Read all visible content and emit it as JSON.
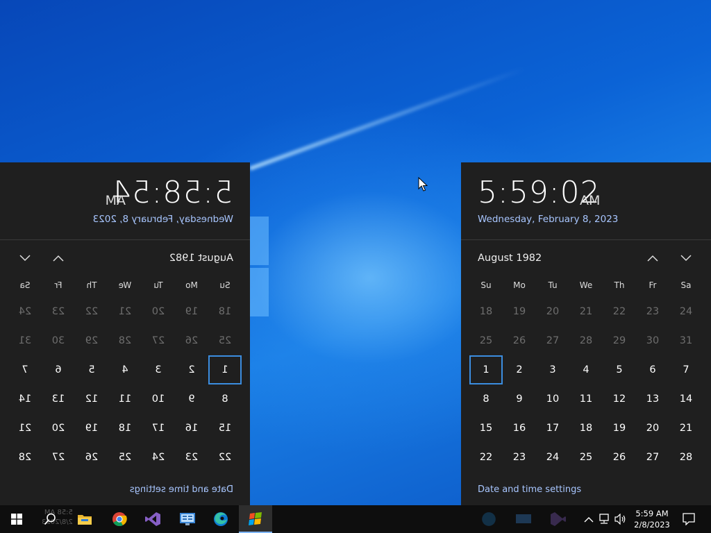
{
  "clock": {
    "time_left": "5:58:54",
    "time_right": "5:59:02",
    "ampm": "AM",
    "date": "Wednesday, February 8, 2023"
  },
  "calendar": {
    "month": "August 1982",
    "weekdays": [
      "Su",
      "Mo",
      "Tu",
      "We",
      "Th",
      "Fr",
      "Sa"
    ],
    "weeks": [
      [
        "18",
        "19",
        "20",
        "21",
        "22",
        "23",
        "24"
      ],
      [
        "25",
        "26",
        "27",
        "28",
        "29",
        "30",
        "31"
      ],
      [
        "1",
        "2",
        "3",
        "4",
        "5",
        "6",
        "7"
      ],
      [
        "8",
        "9",
        "10",
        "11",
        "12",
        "13",
        "14"
      ],
      [
        "15",
        "16",
        "17",
        "18",
        "19",
        "20",
        "21"
      ],
      [
        "22",
        "23",
        "24",
        "25",
        "26",
        "27",
        "28"
      ]
    ],
    "muted_rows": 2,
    "selected": "1",
    "settings_link": "Date and time settings"
  },
  "taskbar": {
    "ghost_time": "5:58 AM",
    "ghost_date": "2/8/2023",
    "apps": [
      {
        "name": "windows-start",
        "icon": "windows-logo-icon"
      },
      {
        "name": "search",
        "icon": "search-icon"
      },
      {
        "name": "file-explorer",
        "icon": "folder-icon"
      },
      {
        "name": "chrome",
        "icon": "chrome-icon"
      },
      {
        "name": "visual-studio",
        "icon": "visual-studio-icon"
      },
      {
        "name": "control-panel",
        "icon": "control-panel-icon"
      },
      {
        "name": "edge",
        "icon": "edge-icon"
      },
      {
        "name": "windows-app",
        "icon": "windows-flag-icon"
      }
    ],
    "tray": {
      "time": "5:59 AM",
      "date": "2/8/2023"
    }
  },
  "colors": {
    "flyout_bg": "#1f1f1f",
    "accent": "#3b8de0",
    "link": "#a8c6ff",
    "taskbar_bg": "#0e0e0e"
  }
}
